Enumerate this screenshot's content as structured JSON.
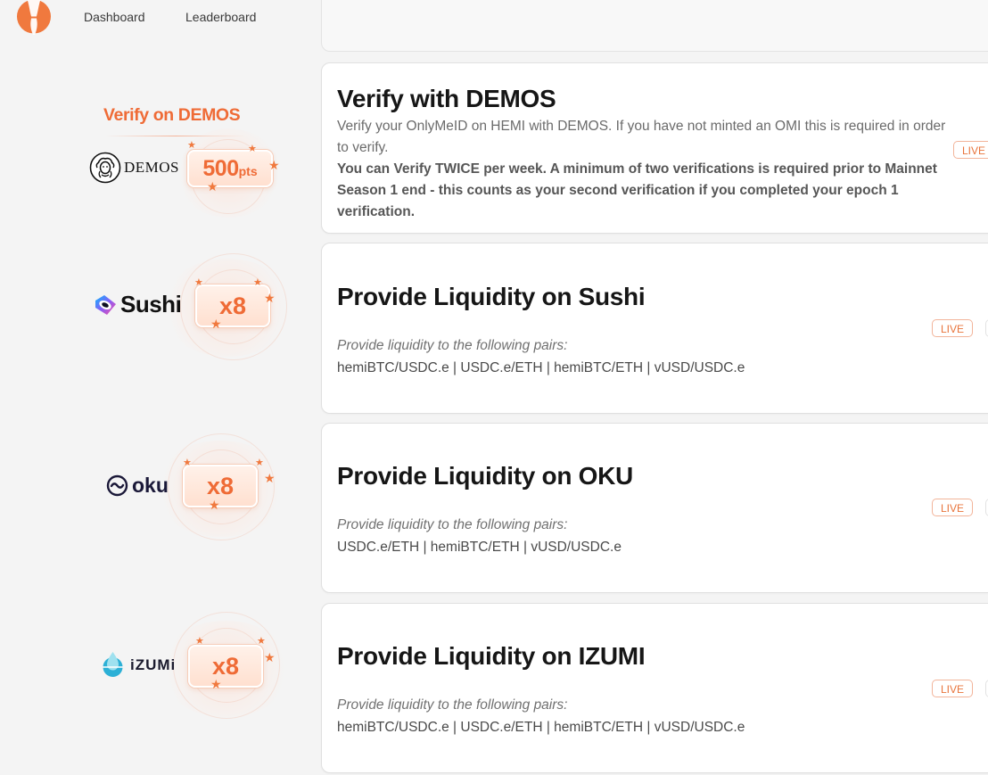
{
  "nav": {
    "logo": "hemi-logo",
    "links": [
      "Dashboard",
      "Leaderboard"
    ]
  },
  "colors": {
    "accent": "#ef6b36",
    "live": "#e8743b",
    "card_bg": "#ffffff",
    "page_bg": "#f4f4f4"
  },
  "quests": [
    {
      "promo_title": "Verify on DEMOS",
      "brand": "DEMOS",
      "brand_icon": "demos-medusa-icon",
      "reward_value": "500",
      "reward_unit": "pts",
      "title": "Verify with DEMOS",
      "description": "Verify your OnlyMeID on HEMI with DEMOS. If you have not minted an OMI this is required in order to verify.",
      "note": "You can Verify TWICE per week. A minimum of two verifications is required prior to Mainnet Season 1 end - this counts as your second verification if you completed your epoch 1 verification.",
      "status": "LIVE"
    },
    {
      "brand": "Sushi",
      "brand_icon": "sushi-icon",
      "reward_value": "x8",
      "title": "Provide Liquidity on Sushi",
      "subtitle": "Provide liquidity to the following pairs:",
      "pairs": "hemiBTC/USDC.e | USDC.e/ETH | hemiBTC/ETH | vUSD/USDC.e",
      "status": "LIVE"
    },
    {
      "brand": "oku",
      "brand_icon": "oku-icon",
      "reward_value": "x8",
      "title": "Provide Liquidity on OKU",
      "subtitle": "Provide liquidity to the following pairs:",
      "pairs": "USDC.e/ETH | hemiBTC/ETH | vUSD/USDC.e",
      "status": "LIVE"
    },
    {
      "brand": "iZUMi",
      "brand_icon": "izumi-drop-icon",
      "reward_value": "x8",
      "title": "Provide Liquidity on IZUMI",
      "subtitle": "Provide liquidity to the following pairs:",
      "pairs": "hemiBTC/USDC.e | USDC.e/ETH | hemiBTC/ETH | vUSD/USDC.e",
      "status": "LIVE"
    }
  ]
}
